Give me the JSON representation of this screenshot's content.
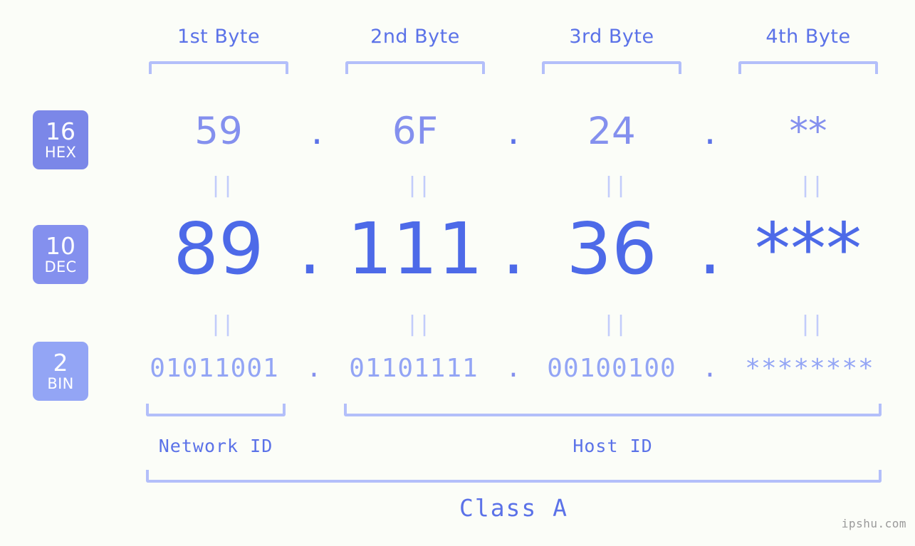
{
  "watermark": "ipshu.com",
  "headers": [
    {
      "label": "1st Byte"
    },
    {
      "label": "2nd Byte"
    },
    {
      "label": "3rd Byte"
    },
    {
      "label": "4th Byte"
    }
  ],
  "radix": [
    {
      "base": "16",
      "name": "HEX",
      "color": "#7b87e8"
    },
    {
      "base": "10",
      "name": "DEC",
      "color": "#8490ee"
    },
    {
      "base": "2",
      "name": "BIN",
      "color": "#93a5f5"
    }
  ],
  "rows": {
    "hex": {
      "base": "16",
      "name": "HEX",
      "values": [
        "59",
        "6F",
        "24",
        "**"
      ],
      "separator": "."
    },
    "dec": {
      "base": "10",
      "name": "DEC",
      "values": [
        "89",
        "111",
        "36",
        "***"
      ],
      "separator": "."
    },
    "bin": {
      "base": "2",
      "name": "BIN",
      "values": [
        "01011001",
        "01101111",
        "00100100",
        "********"
      ],
      "separator": "."
    }
  },
  "equals_mark": "||",
  "segments": {
    "network_id": "Network ID",
    "host_id": "Host ID",
    "class": "Class A"
  },
  "ip": {
    "address": "89.111.36.***",
    "hex": "59.6F.24.**",
    "binary": "01011001.01101111.00100100.********"
  },
  "colors": {
    "background": "#fbfdf8",
    "accent_strong": "#4d6ae8",
    "accent_mid": "#5b72e8",
    "accent_light": "#8490ee",
    "accent_lighter": "#93a5f5",
    "bracket": "#b3bffa",
    "equals": "#c2ccfb",
    "watermark": "#9a9a9a"
  }
}
